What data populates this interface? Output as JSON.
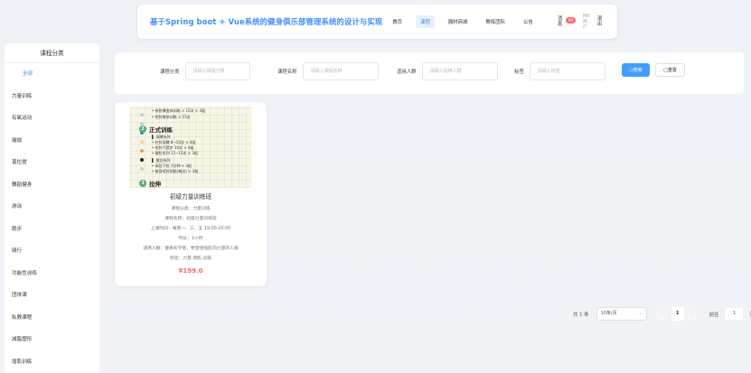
{
  "header": {
    "title": "基于Spring boot + Vue系统的健身俱乐部管理系统的设计与实现",
    "nav": [
      {
        "label": "首页",
        "active": false
      },
      {
        "label": "课程",
        "active": true
      },
      {
        "label": "器材商城",
        "active": false
      },
      {
        "label": "教练团队",
        "active": false
      },
      {
        "label": "公告",
        "active": false
      }
    ],
    "messages_label": "消息",
    "messages_badge": "99",
    "user_label": "MK用户",
    "logout_label": "退出"
  },
  "sidebar": {
    "title": "课程分类",
    "items": [
      {
        "label": "全部",
        "active": true
      },
      {
        "label": "力量训练"
      },
      {
        "label": "有氧运动"
      },
      {
        "label": "瑜伽"
      },
      {
        "label": "普拉提"
      },
      {
        "label": "舞蹈健身"
      },
      {
        "label": "游泳"
      },
      {
        "label": "跑步"
      },
      {
        "label": "骑行"
      },
      {
        "label": "功能性训练"
      },
      {
        "label": "团体课"
      },
      {
        "label": "私教课程"
      },
      {
        "label": "减脂塑形"
      },
      {
        "label": "增肌训练"
      }
    ]
  },
  "search": {
    "fields": [
      {
        "label": "课程分类",
        "placeholder": "请输入课程分类"
      },
      {
        "label": "课程名称",
        "placeholder": "请输入课程名称"
      },
      {
        "label": "适用人群",
        "placeholder": "请输入适用人群"
      },
      {
        "label": "标签",
        "placeholder": "请输入标签"
      }
    ],
    "search_button": "搜索",
    "reset_button": "重置"
  },
  "card": {
    "image": {
      "top_lines": [
        "• 俯卧撑变体训练 × 15次 × 3组",
        "• 哑铃推举训练 × 15次"
      ],
      "section1_num": "2",
      "section1_title": "正式训练",
      "section1_lines": [
        "▌ 深蹲系列",
        "• 杠铃深蹲 8~10次 × 4组",
        "• 哑铃弓箭步 10次 × 4组",
        "• 硬拉系列 12~15次 × 3组",
        "▌ 推拉系列",
        "• 高位下拉 1分钟 × 3组",
        "• 俯身哑铃划船(每边) × 3组"
      ],
      "section2_num": "3",
      "section2_title": "拉伸",
      "dot_colors": [
        "#cccccc",
        "#a9d4f5",
        "#2b7fd4",
        "#f0d890",
        "#e0a060",
        "#222222",
        "#c8d8a0"
      ]
    },
    "title": "初级力量训练班",
    "category": "课程分类：力量训练",
    "name": "课程名称：初级力量训练班",
    "schedule": "上课时间：每周一、三、五 19:00-20:00",
    "duration": "时长：1小时",
    "audience": "适用人群：健身初学者，希望增强肌肉力量的人群",
    "tags": "标签：力量,增肌,初级",
    "price": "¥199.0"
  },
  "pagination": {
    "total": "共 1 条",
    "page_size": "10条/页",
    "prev": "‹",
    "current": "1",
    "next": "›",
    "goto_label": "前往",
    "goto_value": "1",
    "page_suffix": "页"
  }
}
